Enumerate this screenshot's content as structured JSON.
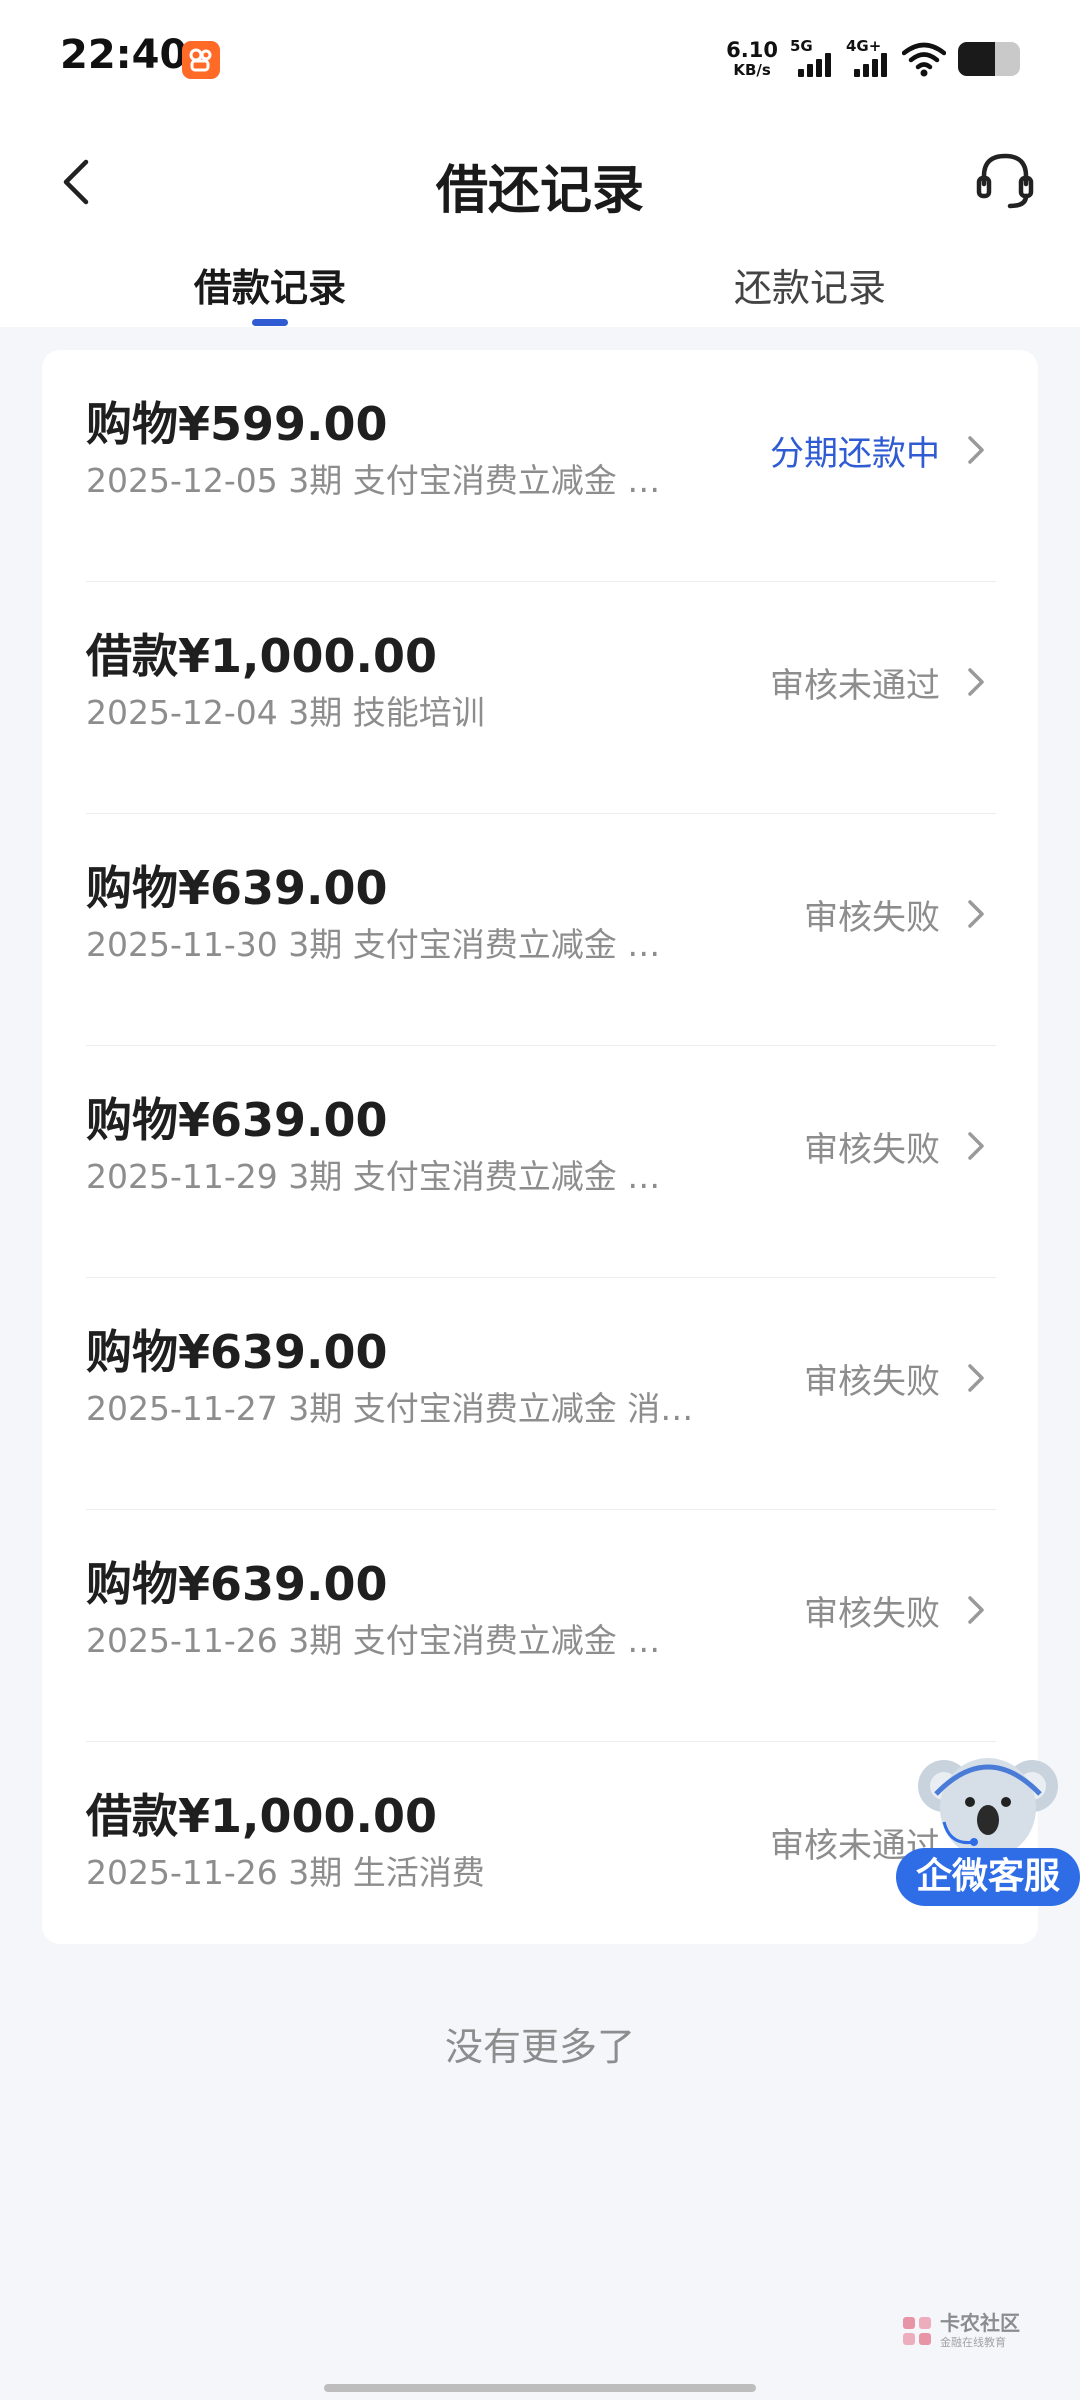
{
  "status_bar": {
    "time": "22:40",
    "app_icon": "kuaishou-app-icon",
    "net_speed_value": "6.10",
    "net_speed_unit": "KB/s",
    "signal_1_label": "5G",
    "signal_2_label": "4G+",
    "wifi_icon": "wifi-icon",
    "battery_level": 0.6
  },
  "header": {
    "title": "借还记录",
    "back_icon": "chevron-left-icon",
    "service_icon": "headset-icon"
  },
  "tabs": [
    {
      "label": "借款记录",
      "active": true
    },
    {
      "label": "还款记录",
      "active": false
    }
  ],
  "records": [
    {
      "amount": "购物¥599.00",
      "detail": "2025-12-05 3期  支付宝消费立减金 …",
      "status": "分期还款中",
      "status_color": "#2f5bd3"
    },
    {
      "amount": "借款¥1,000.00",
      "detail": "2025-12-04 3期  技能培训",
      "status": "审核未通过",
      "status_color": "#8d8d8d"
    },
    {
      "amount": "购物¥639.00",
      "detail": "2025-11-30 3期  支付宝消费立减金 …",
      "status": "审核失败",
      "status_color": "#8d8d8d"
    },
    {
      "amount": "购物¥639.00",
      "detail": "2025-11-29 3期  支付宝消费立减金 …",
      "status": "审核失败",
      "status_color": "#8d8d8d"
    },
    {
      "amount": "购物¥639.00",
      "detail": "2025-11-27 3期  支付宝消费立减金 消…",
      "status": "审核失败",
      "status_color": "#8d8d8d"
    },
    {
      "amount": "购物¥639.00",
      "detail": "2025-11-26 3期  支付宝消费立减金 …",
      "status": "审核失败",
      "status_color": "#8d8d8d"
    },
    {
      "amount": "借款¥1,000.00",
      "detail": "2025-11-26 3期  生活消费",
      "status": "审核未通过",
      "status_color": "#8d8d8d"
    }
  ],
  "footer_text": "没有更多了",
  "floating_service": {
    "label": "企微客服",
    "icon": "koala-mascot-icon"
  },
  "watermark": {
    "text": "卡农社区",
    "sub": "金融在线教育"
  },
  "colors": {
    "accent": "#2f5bd3",
    "background": "#f4f6fa",
    "muted_text": "#8d8d8d",
    "service_pill": "#2f6de6"
  }
}
